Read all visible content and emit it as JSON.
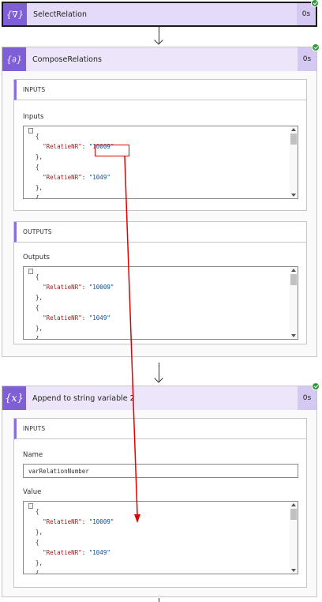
{
  "select_relation": {
    "title": "SelectRelation",
    "duration": "0s",
    "icon": "{∇}"
  },
  "compose_relations": {
    "title": "ComposeRelations",
    "duration": "0s",
    "icon": "{∂}",
    "inputs_section": {
      "heading": "INPUTS",
      "field_label": "Inputs",
      "json": [
        [
          "{",
          "",
          "",
          ""
        ],
        [
          "",
          "\"RelatieNR\"",
          ": ",
          "\"10009\""
        ],
        [
          "},",
          "",
          "",
          ""
        ],
        [
          "{",
          "",
          "",
          ""
        ],
        [
          "",
          "\"RelatieNR\"",
          ": ",
          "\"1049\""
        ],
        [
          "},",
          "",
          "",
          ""
        ],
        [
          "{",
          "",
          "",
          ""
        ]
      ]
    },
    "outputs_section": {
      "heading": "OUTPUTS",
      "field_label": "Outputs",
      "json": [
        [
          "{",
          "",
          "",
          ""
        ],
        [
          "",
          "\"RelatieNR\"",
          ": ",
          "\"10009\""
        ],
        [
          "},",
          "",
          "",
          ""
        ],
        [
          "{",
          "",
          "",
          ""
        ],
        [
          "",
          "\"RelatieNR\"",
          ": ",
          "\"1049\""
        ],
        [
          "},",
          "",
          "",
          ""
        ],
        [
          "{",
          "",
          "",
          ""
        ]
      ]
    }
  },
  "append_variable": {
    "title": "Append to string variable 2",
    "duration": "0s",
    "icon": "{x}",
    "inputs_section": {
      "heading": "INPUTS",
      "name_label": "Name",
      "name_value": "varRelationNumber",
      "value_label": "Value",
      "json": [
        [
          "{",
          "",
          "",
          ""
        ],
        [
          "",
          "\"RelatieNR\"",
          ": ",
          "\"10009\""
        ],
        [
          "},",
          "",
          "",
          ""
        ],
        [
          "{",
          "",
          "",
          ""
        ],
        [
          "",
          "\"RelatieNR\"",
          ": ",
          "\"1049\""
        ],
        [
          "},",
          "",
          "",
          ""
        ],
        [
          "{",
          "",
          "",
          ""
        ]
      ]
    }
  },
  "colors": {
    "accent": "#7f5fd6",
    "header_bg": "#ede6fb",
    "success": "#2e9a39",
    "annotation": "#e00000"
  },
  "icons": {
    "success": "check-circle-icon",
    "connector": "arrow-down-icon",
    "fold": "fold-toggle-icon"
  }
}
